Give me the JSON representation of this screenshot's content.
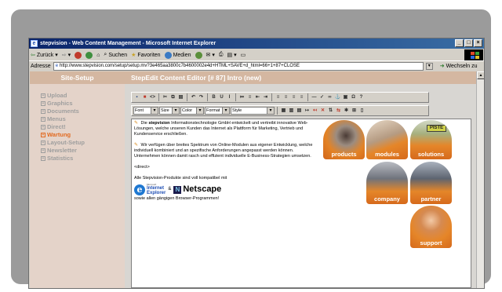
{
  "window": {
    "title": "stepvision - Web Content Management - Microsoft Internet Explorer",
    "buttons": [
      "_",
      "□",
      "×"
    ]
  },
  "ie_toolbar": {
    "items": [
      "Zurück",
      "Suchen",
      "Favoriten",
      "Medien"
    ]
  },
  "addressbar": {
    "label": "Adresse",
    "url": "http://www.stepvision.com/setup/setup.mv?3e465aa3800c7b4600002e4d+HTML+SAVE+d_html=66+1+87+CLOSE",
    "go_label": "Wechseln zu"
  },
  "site": {
    "left_title": "Site-Setup",
    "editor_title": "StepEdit Content Editor [# 87] Intro (new)"
  },
  "sidebar": {
    "items": [
      {
        "label": "Upload",
        "active": false
      },
      {
        "label": "Graphics",
        "active": false
      },
      {
        "label": "Documents",
        "active": false
      },
      {
        "label": "Menus",
        "active": false
      },
      {
        "label": "Direct!",
        "active": false
      },
      {
        "label": "Wartung",
        "active": true
      },
      {
        "label": "Layout-Setup",
        "active": false
      },
      {
        "label": "Newsletter",
        "active": false
      },
      {
        "label": "Statistics",
        "active": false
      }
    ],
    "colors": {
      "normal": "#9e9e9e",
      "active": "#e26a20"
    }
  },
  "editor": {
    "selects": [
      "Font",
      "Size",
      "Color",
      "Format",
      "Style"
    ],
    "row1_icons": [
      "save-icon",
      "close-icon",
      "code-icon",
      "cut-icon",
      "copy-icon",
      "paste-icon",
      "undo-icon",
      "redo-icon",
      "bold-icon",
      "underline-icon",
      "italic-icon",
      "ordered-list-icon",
      "unordered-list-icon",
      "outdent-icon",
      "indent-icon",
      "align-left-icon",
      "align-center-icon",
      "align-right-icon",
      "align-justify-icon",
      "horizontal-rule-icon",
      "spellcheck-icon",
      "link-icon",
      "anchor-icon",
      "image-icon",
      "special-char-icon",
      "help-icon"
    ],
    "row1_glyphs": [
      "▪",
      "■",
      "<>",
      "✂",
      "⧉",
      "▤",
      "↶",
      "↷",
      "B",
      "U",
      "I",
      "≔",
      "≡",
      "⇤",
      "⇥",
      "≡",
      "≡",
      "≡",
      "≡",
      "—",
      "✓",
      "∞",
      "⚓",
      "▣",
      "Ω",
      "?"
    ],
    "row2_icons": [
      "table-icon",
      "table-props-icon",
      "cell-props-icon",
      "insert-row-icon",
      "delete-row-icon",
      "merge-cells-icon",
      "insert-col-icon",
      "delete-col-icon",
      "split-cell-icon",
      "borders-icon",
      "layer-icon"
    ],
    "row2_glyphs": [
      "▦",
      "▥",
      "▤",
      "↦",
      "↤",
      "✕",
      "⇅",
      "⇆",
      "✱",
      "⊞",
      "▯"
    ]
  },
  "document": {
    "p1_prefix": "Die",
    "p1_bold": "stepvision",
    "p1_rest": "Informationstechnologie GmbH entwickelt und vertreibt innovative Web-Lösungen, welche unseren Kunden das Internet als Plattform für Marketing, Vertrieb und Kundenservice erschließen.",
    "p2": "Wir verfügen über breites Spektrum von Online-Modulen aus eigener Entwicklung, welche individuell kombiniert und an spezifische Anforderungen angepasst werden können. Unternehmen können damit rasch und effizient individuelle E-Business-Strategien umsetzen.",
    "direct": "<direct>",
    "compat": "Alle Stepvision-Produkte sind voll kompatibel mit",
    "ie_small": "Microsoft",
    "ie_line1": "Internet",
    "ie_line2": "Explorer",
    "and": "&",
    "netscape": "Netscape",
    "outro": "sowie allen gängigen Browser-Programmen!",
    "tiles": [
      "products",
      "modules",
      "solutions",
      "company",
      "partner",
      "support"
    ]
  }
}
